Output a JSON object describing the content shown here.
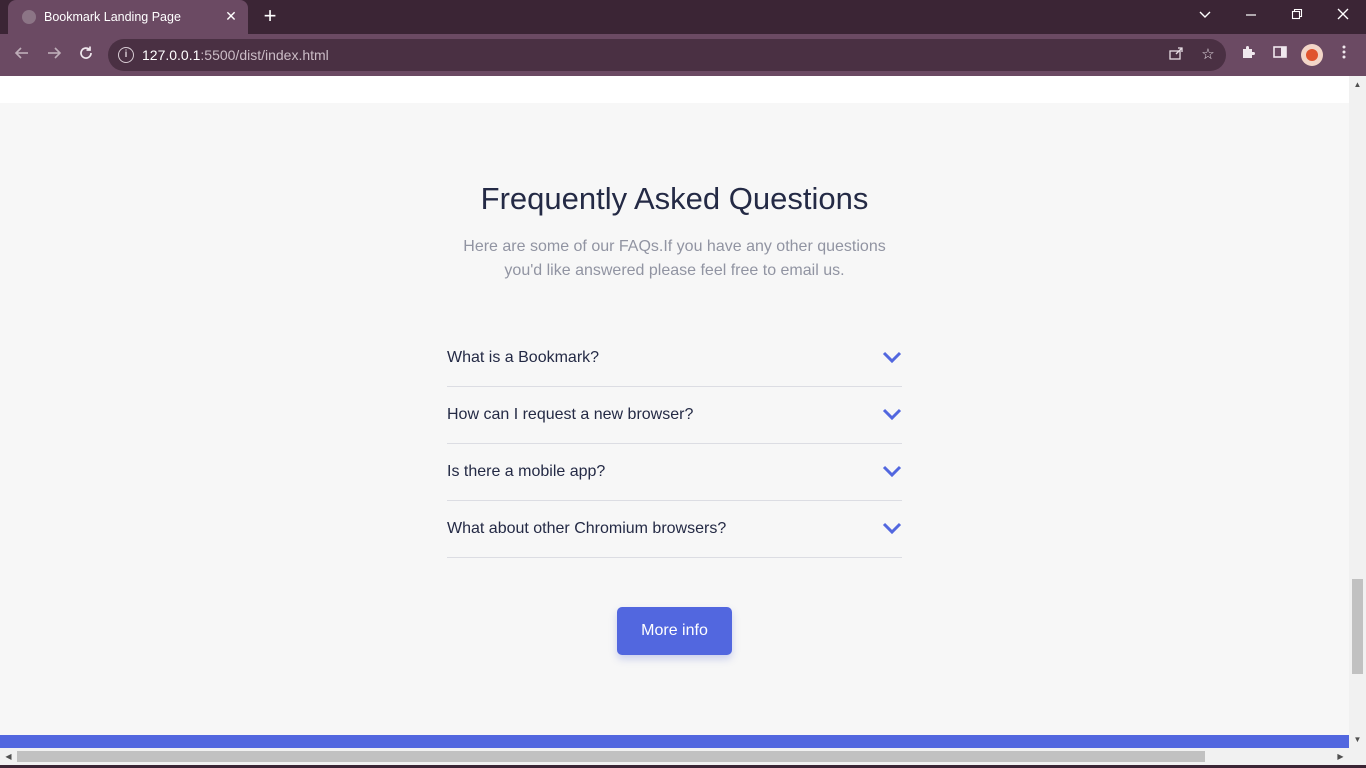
{
  "browser": {
    "tab_title": "Bookmark Landing Page",
    "tab_close": "✕",
    "new_tab": "+",
    "url_host": "127.0.0.1",
    "url_rest": ":5500/dist/index.html",
    "window_controls": {
      "dropdown": "⌄",
      "minimize": "─",
      "restore": "❐",
      "close": "✕"
    },
    "theme_color": "#6b4a63",
    "titlebar_color": "#3b2535"
  },
  "faq": {
    "title": "Frequently Asked Questions",
    "subtitle": "Here are some of our FAQs.If you have any other questions you'd like answered please feel free to email us.",
    "questions": [
      {
        "label": "What is a Bookmark?"
      },
      {
        "label": "How can I request a new browser?"
      },
      {
        "label": "Is there a mobile app?"
      },
      {
        "label": "What about other Chromium browsers?"
      }
    ],
    "more_button": "More info",
    "accent_color": "#5267df",
    "heading_color": "#242a45"
  }
}
